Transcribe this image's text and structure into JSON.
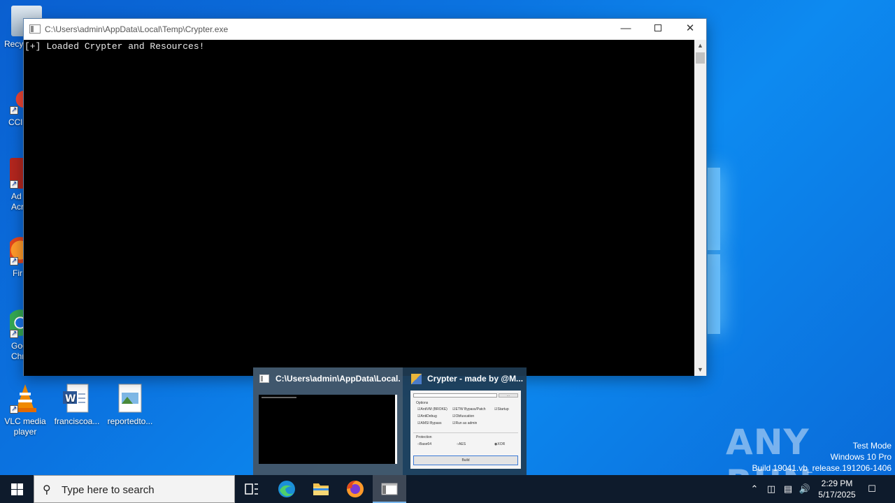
{
  "console": {
    "title": "C:\\Users\\admin\\AppData\\Local\\Temp\\Crypter.exe",
    "output": "[+] Loaded Crypter and Resources!",
    "minimize": "—",
    "close": "✕"
  },
  "desktop": {
    "icons": [
      {
        "label": "Recy"
      },
      {
        "label": "CCl"
      },
      {
        "label": "Ad Acr"
      },
      {
        "label": "Fir"
      },
      {
        "label": "Goo Chr"
      },
      {
        "label": "VLC media player"
      },
      {
        "label": "franciscoa..."
      },
      {
        "label": "reportedto..."
      }
    ]
  },
  "thumbnails": {
    "items": [
      {
        "title": "C:\\Users\\admin\\AppData\\Local..."
      },
      {
        "title": "Crypter - made by @M..."
      }
    ],
    "crypter_preview": {
      "options_label": "Options",
      "options": [
        "AntiVM (BROKE)",
        "ETW Bypass/Patch",
        "Startup",
        "AntiDebug",
        "Obfuscation",
        "AMSI Bypass",
        "Run as admin"
      ],
      "protection_label": "Protection",
      "protections": [
        "Base64",
        "AES",
        "XOR"
      ],
      "browse": "...",
      "build": "Build"
    }
  },
  "watermark": {
    "brand": "ANY RUN",
    "line1": "Test Mode",
    "line2": "Windows 10 Pro",
    "line3": "Build 19041.vb_release.191206-1406"
  },
  "taskbar": {
    "search_placeholder": "Type here to search",
    "time": "2:29 PM",
    "date": "5/17/2025"
  },
  "colors": {
    "desktop": "#0b73e0",
    "taskbar": "#0e1b2c",
    "console_bg": "#000000"
  }
}
